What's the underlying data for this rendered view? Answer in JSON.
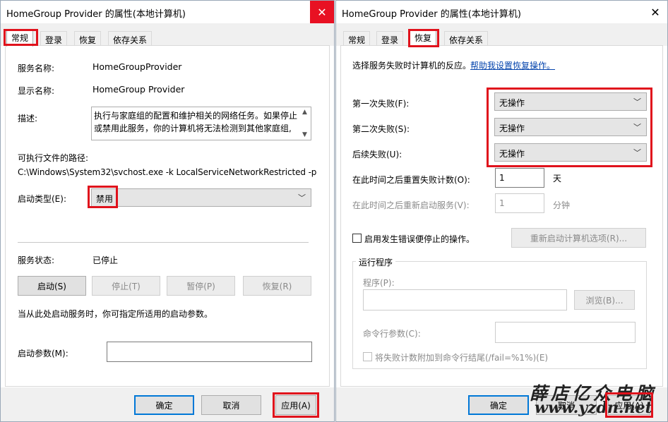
{
  "left_dialog": {
    "title": "HomeGroup Provider 的属性(本地计算机)",
    "close_glyph": "✕",
    "tabs": [
      {
        "label": "常规"
      },
      {
        "label": "登录"
      },
      {
        "label": "恢复"
      },
      {
        "label": "依存关系"
      }
    ],
    "service_name_label": "服务名称:",
    "service_name_value": "HomeGroupProvider",
    "display_name_label": "显示名称:",
    "display_name_value": "HomeGroup Provider",
    "description_label": "描述:",
    "description_line1": "执行与家庭组的配置和维护相关的网络任务。如果停止",
    "description_line2": "或禁用此服务，你的计算机将无法检测到其他家庭组,",
    "exe_path_label": "可执行文件的路径:",
    "exe_path_value": "C:\\Windows\\System32\\svchost.exe -k LocalServiceNetworkRestricted -p",
    "startup_type_label": "启动类型(E):",
    "startup_type_value": "禁用",
    "service_status_label": "服务状态:",
    "service_status_value": "已停止",
    "control_buttons": {
      "start": "启动(S)",
      "stop": "停止(T)",
      "pause": "暂停(P)",
      "resume": "恢复(R)"
    },
    "hint_text": "当从此处启动服务时，你可指定所适用的启动参数。",
    "start_params_label": "启动参数(M):",
    "start_params_value": "",
    "footer": {
      "ok": "确定",
      "cancel": "取消",
      "apply": "应用(A)"
    }
  },
  "right_dialog": {
    "title": "HomeGroup Provider 的属性(本地计算机)",
    "close_glyph": "✕",
    "tabs": [
      {
        "label": "常规"
      },
      {
        "label": "登录"
      },
      {
        "label": "恢复"
      },
      {
        "label": "依存关系"
      }
    ],
    "intro_text": "选择服务失败时计算机的反应。",
    "help_link": "帮助我设置恢复操作。",
    "first_failure_label": "第一次失败(F):",
    "first_failure_value": "无操作",
    "second_failure_label": "第二次失败(S):",
    "second_failure_value": "无操作",
    "subsequent_failure_label": "后续失败(U):",
    "subsequent_failure_value": "无操作",
    "reset_count_label": "在此时间之后重置失败计数(O):",
    "reset_count_value": "1",
    "reset_count_unit": "天",
    "restart_service_label": "在此时间之后重新启动服务(V):",
    "restart_service_value": "1",
    "restart_service_unit": "分钟",
    "enable_actions_label": "启用发生错误便停止的操作。",
    "restart_options_button": "重新启动计算机选项(R)...",
    "run_program_group": "运行程序",
    "program_label": "程序(P):",
    "program_value": "",
    "browse_button": "浏览(B)...",
    "cmd_params_label": "命令行参数(C):",
    "cmd_params_value": "",
    "append_fail_count_label": "将失败计数附加到命令行结尾(/fail=%1%)(E)",
    "footer": {
      "ok": "确定",
      "cancel": "取消",
      "apply": "应用(A)"
    }
  },
  "watermark": {
    "brand": "薛店亿众电脑",
    "url": "www.yzdn.net"
  },
  "colors": {
    "highlight_red": "#e0121c",
    "close_red": "#e81123",
    "link_blue": "#0645ad",
    "focus_blue": "#0078d7"
  }
}
